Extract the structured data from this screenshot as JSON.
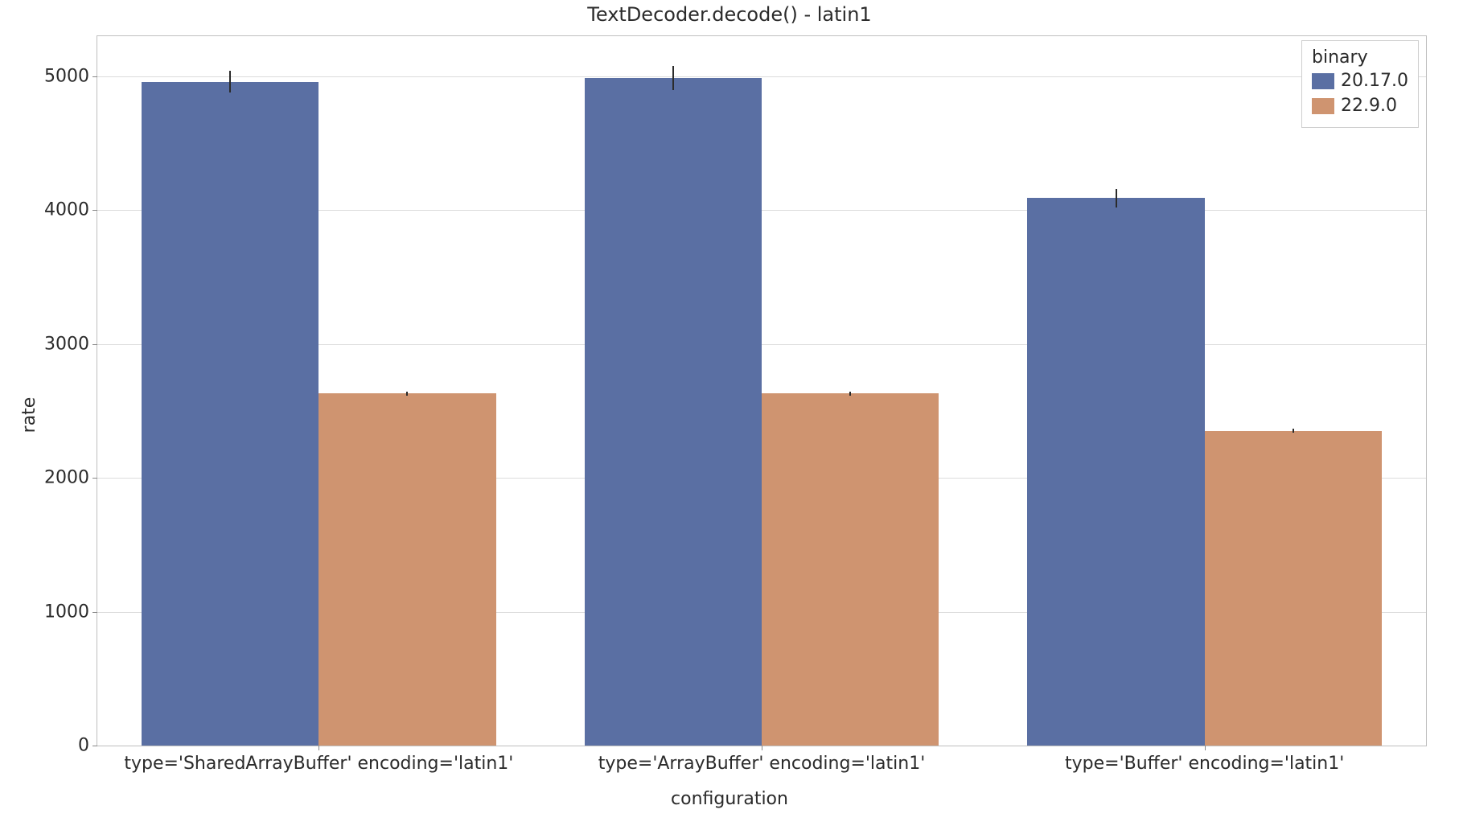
{
  "chart_data": {
    "type": "bar",
    "title": "TextDecoder.decode() - latin1",
    "xlabel": "configuration",
    "ylabel": "rate",
    "ylim": [
      0,
      5300
    ],
    "yticks": [
      0,
      1000,
      2000,
      3000,
      4000,
      5000
    ],
    "categories": [
      "type='SharedArrayBuffer' encoding='latin1'",
      "type='ArrayBuffer' encoding='latin1'",
      "type='Buffer' encoding='latin1'"
    ],
    "legend_title": "binary",
    "series": [
      {
        "name": "20.17.0",
        "color": "#5a6fa3",
        "values": [
          4960,
          4990,
          4090
        ],
        "errors": [
          80,
          90,
          70
        ]
      },
      {
        "name": "22.9.0",
        "color": "#cf9470",
        "values": [
          2630,
          2630,
          2350
        ],
        "errors": [
          15,
          15,
          15
        ]
      }
    ],
    "bar_gap_within_group": 0,
    "group_gap_ratio": 0.2
  }
}
